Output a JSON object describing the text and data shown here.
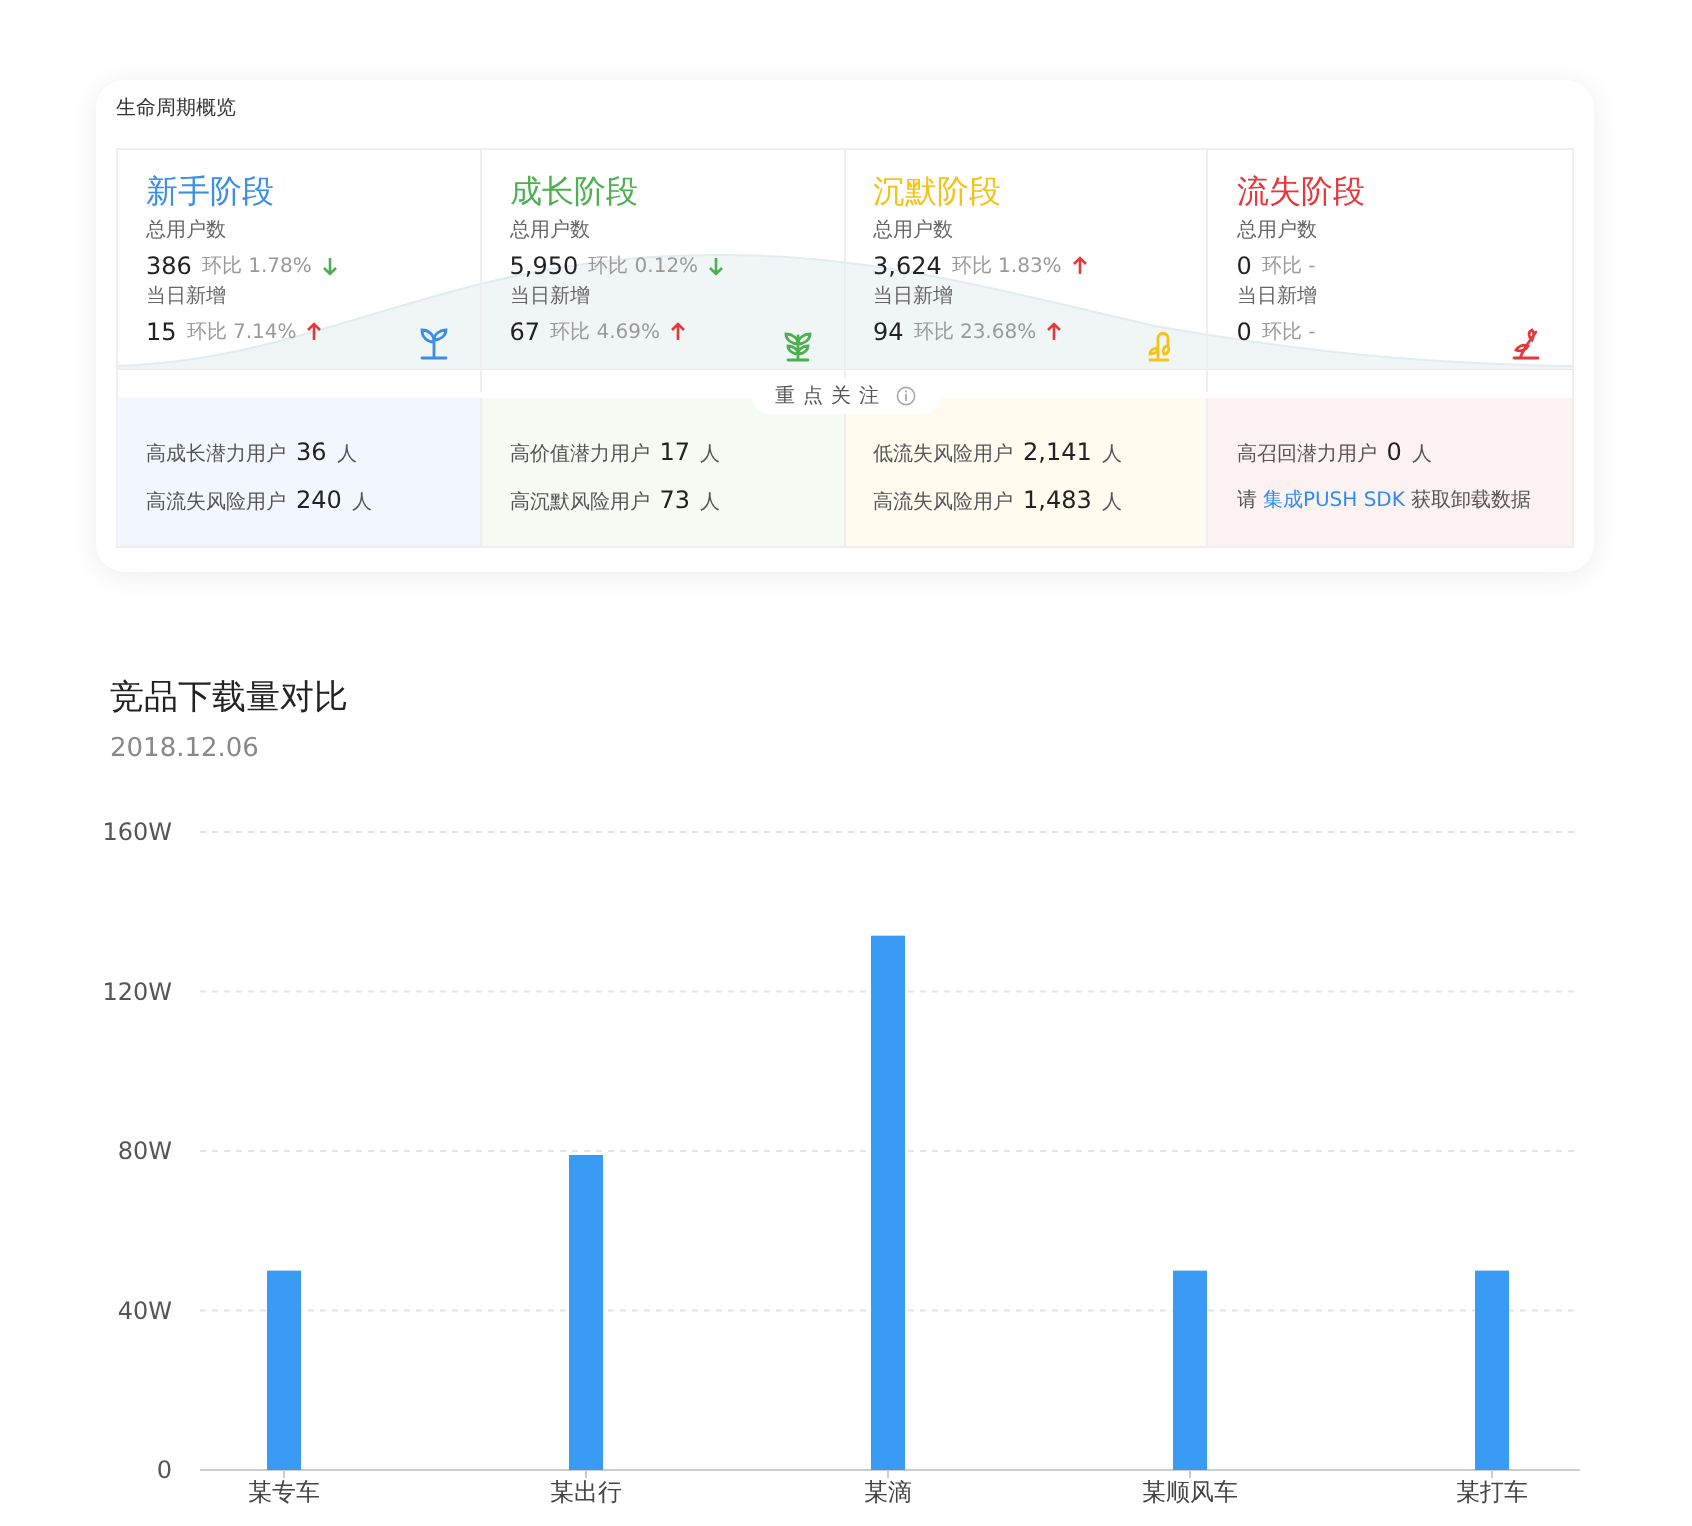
{
  "lifecycle": {
    "title": "生命周期概览",
    "stages": [
      {
        "kind": "newbie",
        "title": "新手阶段",
        "color": "#3a8ee6",
        "total_label": "总用户数",
        "total": "386",
        "total_ratio_label": "环比",
        "total_ratio": "1.78%",
        "total_rising": false,
        "new_label": "当日新增",
        "new": "15",
        "new_ratio_label": "环比",
        "new_ratio": "7.14%",
        "new_rising": true,
        "focus": [
          {
            "kind": "count",
            "label": "高成长潜力用户",
            "value": "36",
            "unit": "人"
          },
          {
            "kind": "count",
            "label": "高流失风险用户",
            "value": "240",
            "unit": "人"
          }
        ]
      },
      {
        "kind": "growth",
        "title": "成长阶段",
        "color": "#4caf50",
        "total_label": "总用户数",
        "total": "5,950",
        "total_ratio_label": "环比",
        "total_ratio": "0.12%",
        "total_rising": false,
        "new_label": "当日新增",
        "new": "67",
        "new_ratio_label": "环比",
        "new_ratio": "4.69%",
        "new_rising": true,
        "focus": [
          {
            "kind": "count",
            "label": "高价值潜力用户",
            "value": "17",
            "unit": "人"
          },
          {
            "kind": "count",
            "label": "高沉默风险用户",
            "value": "73",
            "unit": "人"
          }
        ]
      },
      {
        "kind": "silent",
        "title": "沉默阶段",
        "color": "#f2c318",
        "total_label": "总用户数",
        "total": "3,624",
        "total_ratio_label": "环比",
        "total_ratio": "1.83%",
        "total_rising": true,
        "new_label": "当日新增",
        "new": "94",
        "new_ratio_label": "环比",
        "new_ratio": "23.68%",
        "new_rising": true,
        "focus": [
          {
            "kind": "count",
            "label": "低流失风险用户",
            "value": "2,141",
            "unit": "人"
          },
          {
            "kind": "count",
            "label": "高流失风险用户",
            "value": "1,483",
            "unit": "人"
          }
        ]
      },
      {
        "kind": "lost",
        "title": "流失阶段",
        "color": "#e5383b",
        "total_label": "总用户数",
        "total": "0",
        "total_ratio_label": "环比",
        "total_ratio": "-",
        "new_label": "当日新增",
        "new": "0",
        "new_ratio_label": "环比",
        "new_ratio": "-",
        "focus": [
          {
            "kind": "count",
            "label": "高召回潜力用户",
            "value": "0",
            "unit": "人"
          },
          {
            "kind": "notice",
            "prefix": "请",
            "link": "集成PUSH SDK",
            "suffix": "获取卸载数据"
          }
        ]
      }
    ],
    "focus_label": "重点关注"
  },
  "downloads": {
    "title": "竞品下载量对比",
    "date": "2018.12.06",
    "chart_data": {
      "type": "bar",
      "categories": [
        "某专车",
        "某出行",
        "某滴",
        "某顺风车",
        "某打车"
      ],
      "series": [
        {
          "color": "#3a9bf5",
          "values": [
            50,
            79,
            134,
            50,
            50
          ]
        }
      ],
      "grid": true,
      "ylim": [
        0,
        160
      ],
      "yticks": [
        {
          "value": 0,
          "label": "0"
        },
        {
          "value": 40,
          "label": "40W"
        },
        {
          "value": 80,
          "label": "80W"
        },
        {
          "value": 120,
          "label": "120W"
        },
        {
          "value": 160,
          "label": "160W"
        }
      ]
    }
  }
}
